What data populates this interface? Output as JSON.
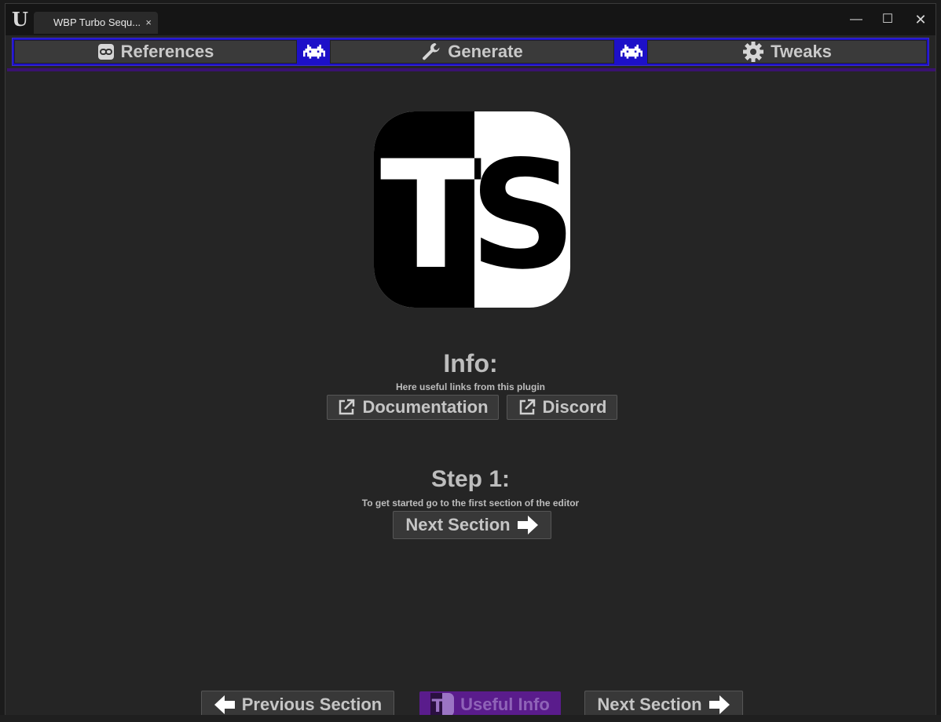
{
  "window": {
    "tab_title": "WBP Turbo Sequ...",
    "tab_close": "×"
  },
  "nav": {
    "references_label": "References",
    "generate_label": "Generate",
    "tweaks_label": "Tweaks"
  },
  "logo": {
    "text": "TS"
  },
  "info": {
    "heading": "Info:",
    "subtitle": "Here useful links from this plugin",
    "documentation_label": "Documentation",
    "discord_label": "Discord"
  },
  "step1": {
    "heading": "Step 1:",
    "subtitle": "To get started go to the first section of the editor",
    "next_label": "Next Section"
  },
  "footer": {
    "previous_label": "Previous Section",
    "useful_label": "Useful Info",
    "next_label": "Next Section"
  },
  "colors": {
    "accent_blue": "#1d10c8",
    "accent_purple": "#5a1c8c",
    "background": "#252525"
  }
}
